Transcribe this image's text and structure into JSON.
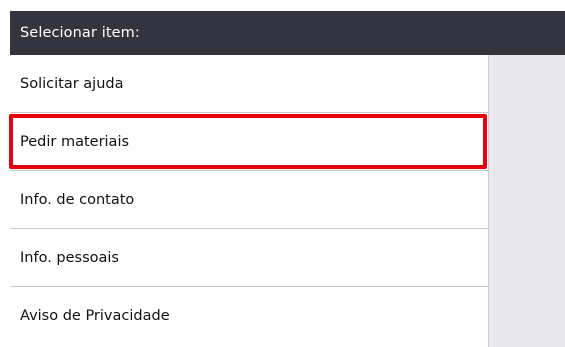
{
  "header": {
    "title": "Selecionar item:"
  },
  "menu": {
    "items": [
      {
        "label": "Solicitar ajuda"
      },
      {
        "label": "Pedir materiais"
      },
      {
        "label": "Info. de contato"
      },
      {
        "label": "Info. pessoais"
      },
      {
        "label": "Aviso de Privacidade"
      }
    ],
    "selected_index": 1
  },
  "colors": {
    "title_bar": "#34343e",
    "highlight": "#e8000b",
    "side_panel": "#e8e8ec"
  }
}
